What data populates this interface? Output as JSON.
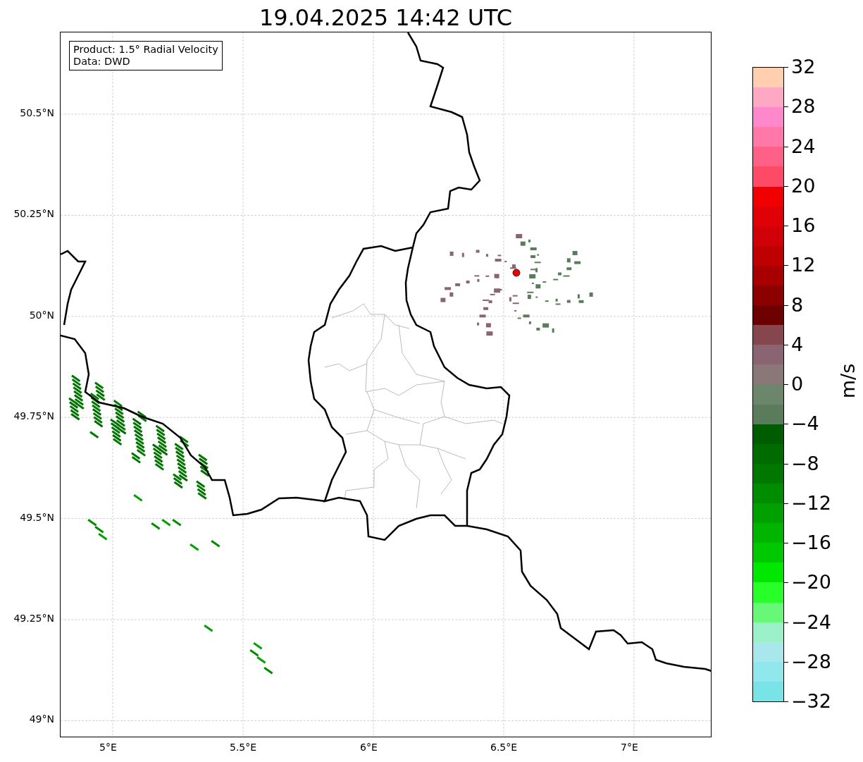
{
  "title": "19.04.2025 14:42 UTC",
  "info_box": {
    "lines": [
      "Product: 1.5° Radial Velocity",
      "Data: DWD"
    ]
  },
  "map": {
    "x_ticks": [
      "5°E",
      "5.5°E",
      "6°E",
      "6.5°E",
      "7°E"
    ],
    "y_ticks": [
      "50.5°N",
      "50.25°N",
      "50°N",
      "49.75°N",
      "49.5°N",
      "49.25°N",
      "49°N"
    ]
  },
  "colorbar": {
    "label": "m/s",
    "ticks": [
      "32",
      "28",
      "24",
      "20",
      "16",
      "12",
      "8",
      "4",
      "0",
      "−4",
      "−8",
      "−12",
      "−16",
      "−20",
      "−24",
      "−28",
      "−32"
    ],
    "bands": [
      {
        "color": "#ffcfb0"
      },
      {
        "color": "#ffa8c4"
      },
      {
        "color": "#ff88cc"
      },
      {
        "color": "#ff78a8"
      },
      {
        "color": "#ff6088"
      },
      {
        "color": "#ff4a66"
      },
      {
        "color": "#f00000"
      },
      {
        "color": "#e00008"
      },
      {
        "color": "#d00008"
      },
      {
        "color": "#be0000"
      },
      {
        "color": "#a80000"
      },
      {
        "color": "#8c0000"
      },
      {
        "color": "#6c0000"
      },
      {
        "color": "#86464e"
      },
      {
        "color": "#8a6470"
      },
      {
        "color": "#8a7878"
      },
      {
        "color": "#6c866c"
      },
      {
        "color": "#5a7c5a"
      },
      {
        "color": "#005c00"
      },
      {
        "color": "#006c00"
      },
      {
        "color": "#007800"
      },
      {
        "color": "#008c00"
      },
      {
        "color": "#00a000"
      },
      {
        "color": "#00b400"
      },
      {
        "color": "#00c800"
      },
      {
        "color": "#00e800"
      },
      {
        "color": "#28ff28"
      },
      {
        "color": "#68f878"
      },
      {
        "color": "#9cf0c8"
      },
      {
        "color": "#a8e8ec"
      },
      {
        "color": "#90e8ec"
      },
      {
        "color": "#78e4e8"
      }
    ]
  }
}
